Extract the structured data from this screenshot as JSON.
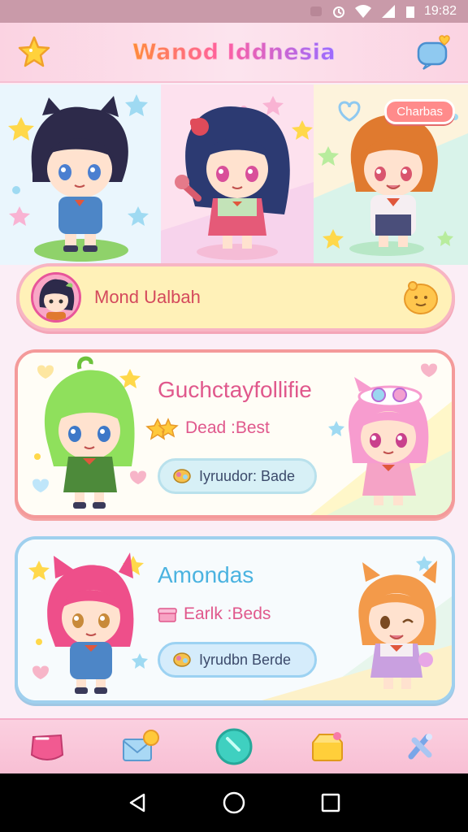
{
  "status_bar": {
    "time": "19:82"
  },
  "header": {
    "title": "Wanod Iddnesia",
    "star_icon": "star-icon",
    "heart_icon": "heart-chat-icon"
  },
  "hero": {
    "badge": "Charbas"
  },
  "profile": {
    "name": "Mond Ualbah"
  },
  "cards": [
    {
      "title": "Guchctayfollifie",
      "subtitle": "Dead :Best",
      "pill": "Iyruudor: Bade",
      "accent": "#e0588c"
    },
    {
      "title": "Amondas",
      "subtitle": "Earlk :Beds",
      "pill": "Iyrudbn Berde",
      "accent": "#4bb3e0"
    }
  ],
  "tabs": [
    "pink-heart-icon",
    "envelope-icon",
    "orb-icon",
    "treasure-box-icon",
    "sparkle-cross-icon"
  ],
  "colors": {
    "pink": "#f8bfd4",
    "coral": "#f49a9a",
    "sky": "#9fd0ee",
    "cream": "#fff1b8"
  }
}
